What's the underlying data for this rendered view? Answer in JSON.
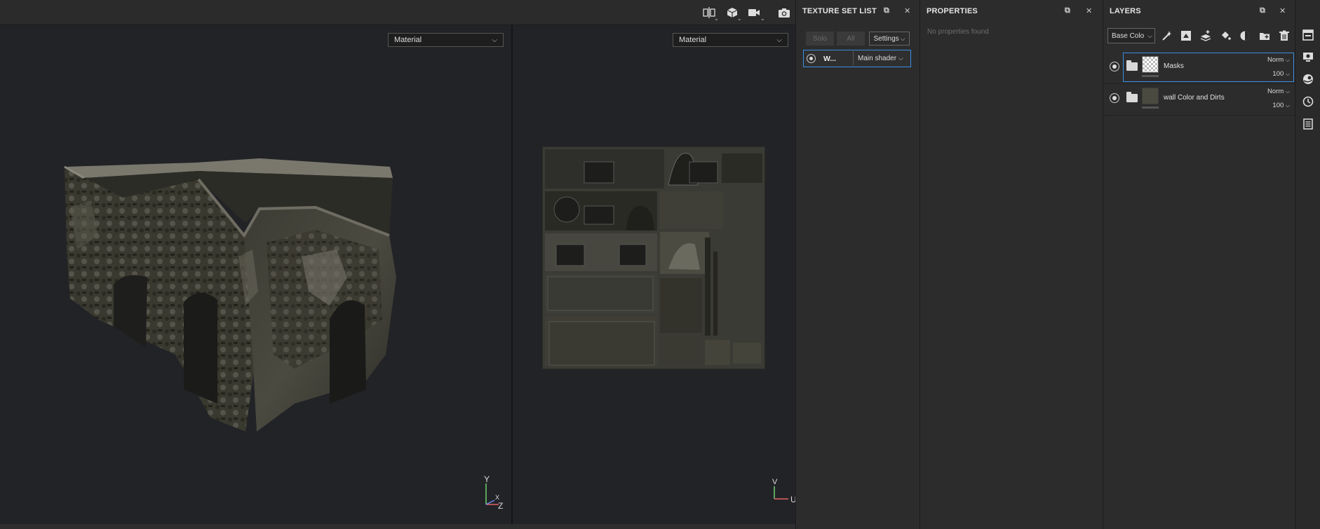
{
  "toolbar": {
    "icons": [
      "split-view-icon",
      "cube-view-icon",
      "camera-video-icon",
      "screenshot-icon"
    ]
  },
  "viewport_3d": {
    "mode": "Material",
    "axis": {
      "y": "Y",
      "x": "X",
      "z": "Z"
    }
  },
  "viewport_2d": {
    "mode": "Material",
    "axis": {
      "v": "V",
      "u": "U"
    }
  },
  "texture_set_list": {
    "title": "TEXTURE SET LIST",
    "solo_label": "Solo",
    "all_label": "All",
    "settings_label": "Settings",
    "item": {
      "name": "W...",
      "shader": "Main shader"
    }
  },
  "properties": {
    "title": "PROPERTIES",
    "empty_text": "No properties found"
  },
  "layers": {
    "title": "LAYERS",
    "channel": "Base Colo",
    "items": [
      {
        "name": "Masks",
        "blend": "Norm",
        "opacity": "100",
        "selected": true
      },
      {
        "name": "wall Color and Dirts",
        "blend": "Norm",
        "opacity": "100",
        "selected": false
      }
    ]
  },
  "sidebar": {
    "icons": [
      "texture-set-settings-icon",
      "display-settings-icon",
      "shader-settings-icon",
      "history-icon",
      "log-icon"
    ]
  },
  "colors": {
    "accent": "#3a8ee6",
    "panel_bg": "#2c2c2c",
    "viewport_bg": "#222327"
  }
}
